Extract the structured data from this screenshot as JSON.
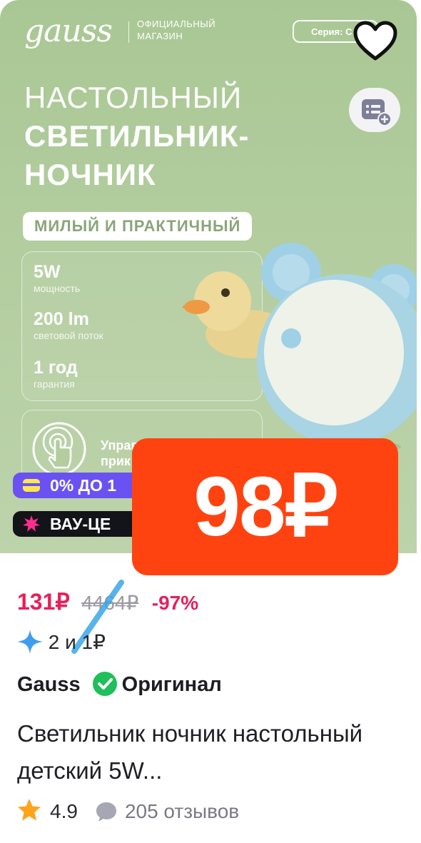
{
  "hero": {
    "brand": "gauss",
    "brand_sub": "Официальный магазин",
    "series": "Серия: C",
    "title_line1": "НАСТОЛЬНЫЙ",
    "title_line2": "СВЕТИЛЬНИК-",
    "title_line3": "НОЧНИК",
    "tagline": "МИЛЫЙ И ПРАКТИЧНЫЙ",
    "specs": [
      {
        "value": "5W",
        "label": "мощность"
      },
      {
        "value": "200 lm",
        "label": "световой поток"
      },
      {
        "value": "1 год",
        "label": "гарантия"
      }
    ],
    "touch_text": "Управ прик"
  },
  "badges": {
    "credit": "0% ДО 1",
    "wow": "ВАУ-ЦЕ"
  },
  "big_price": "98₽",
  "product": {
    "price": "131₽",
    "old_price": "4464₽",
    "discount": "-97%",
    "bonus": "2 и 1₽",
    "brand": "Gauss",
    "original_label": "Оригинал",
    "name": "Светильник ночник настольный детский 5W...",
    "rating": "4.9",
    "reviews": "205 отзывов"
  },
  "colors": {
    "hero_bg": "#b3cd9f",
    "price_accent": "#e6205b",
    "big_price_bg": "#ff4310",
    "credit_badge": "#6a52f2",
    "wow_badge": "#13131a",
    "original_check": "#1fbf5a",
    "star": "#ffa31a"
  },
  "icons": [
    "heart-icon",
    "bookmark-add-icon",
    "touch-hand-icon",
    "card-icon",
    "burst-icon",
    "sparkle-icon",
    "check-icon",
    "star-icon",
    "chat-bubble-icon"
  ]
}
